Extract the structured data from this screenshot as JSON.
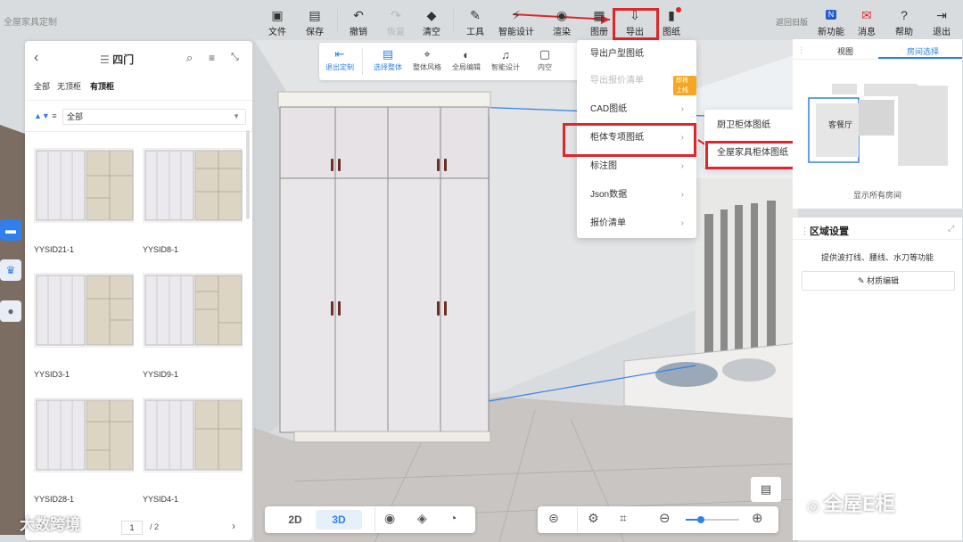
{
  "brand": "全屋家具定制",
  "toolbar": {
    "file": "文件",
    "save": "保存",
    "undo": "撤销",
    "redo": "恢复",
    "clear": "清空",
    "tools": "工具",
    "smart_design": "智能设计",
    "render": "渲染",
    "album": "图册",
    "export": "导出",
    "drawings": "图纸",
    "back_old": "返回旧版",
    "new_features": "新功能",
    "messages": "消息",
    "help": "帮助",
    "exit": "退出"
  },
  "left_panel": {
    "title": "四门",
    "filters": [
      "全部",
      "无顶柜",
      "有顶柜"
    ],
    "sort_value": "全部",
    "items": [
      {
        "name": "YYSID21-1"
      },
      {
        "name": "YYSID8-1"
      },
      {
        "name": "YYSID3-1"
      },
      {
        "name": "YYSID9-1"
      },
      {
        "name": "YYSID28-1"
      },
      {
        "name": "YYSID4-1"
      }
    ],
    "pagination": {
      "current": "1",
      "total": "/ 2"
    }
  },
  "edit_bar": {
    "exit_custom": "退出定制",
    "select_whole": "选择整体",
    "overall_style": "整体风格",
    "global_edit": "全局编辑",
    "smart_design": "智能设计",
    "inner": "内空"
  },
  "export_menu": {
    "items": [
      {
        "label": "导出户型图纸",
        "disabled": false
      },
      {
        "label": "导出报价清单",
        "disabled": true,
        "badge": "即将上线"
      },
      {
        "label": "CAD图纸",
        "disabled": false
      },
      {
        "label": "柜体专项图纸",
        "disabled": false
      },
      {
        "label": "标注图",
        "disabled": false
      },
      {
        "label": "Json数据",
        "disabled": false
      },
      {
        "label": "报价清单",
        "disabled": false
      }
    ],
    "submenu": [
      "厨卫柜体图纸",
      "全屋家具柜体图纸"
    ]
  },
  "right_panel": {
    "tabs": [
      "视图",
      "房间选择"
    ],
    "room_label": "客餐厅",
    "show_all_rooms": "显示所有房间",
    "area_title": "区域设置",
    "area_desc": "提供波打线、腰线、水刀等功能",
    "material_edit": "材质编辑"
  },
  "bottom_bar": {
    "view_2d": "2D",
    "view_3d": "3D"
  },
  "watermarks": {
    "left": "大数跨境",
    "right": "全屋E柜"
  },
  "colors": {
    "accent": "#2f80ed",
    "highlight": "#e0262b",
    "badge": "#f5a623"
  }
}
